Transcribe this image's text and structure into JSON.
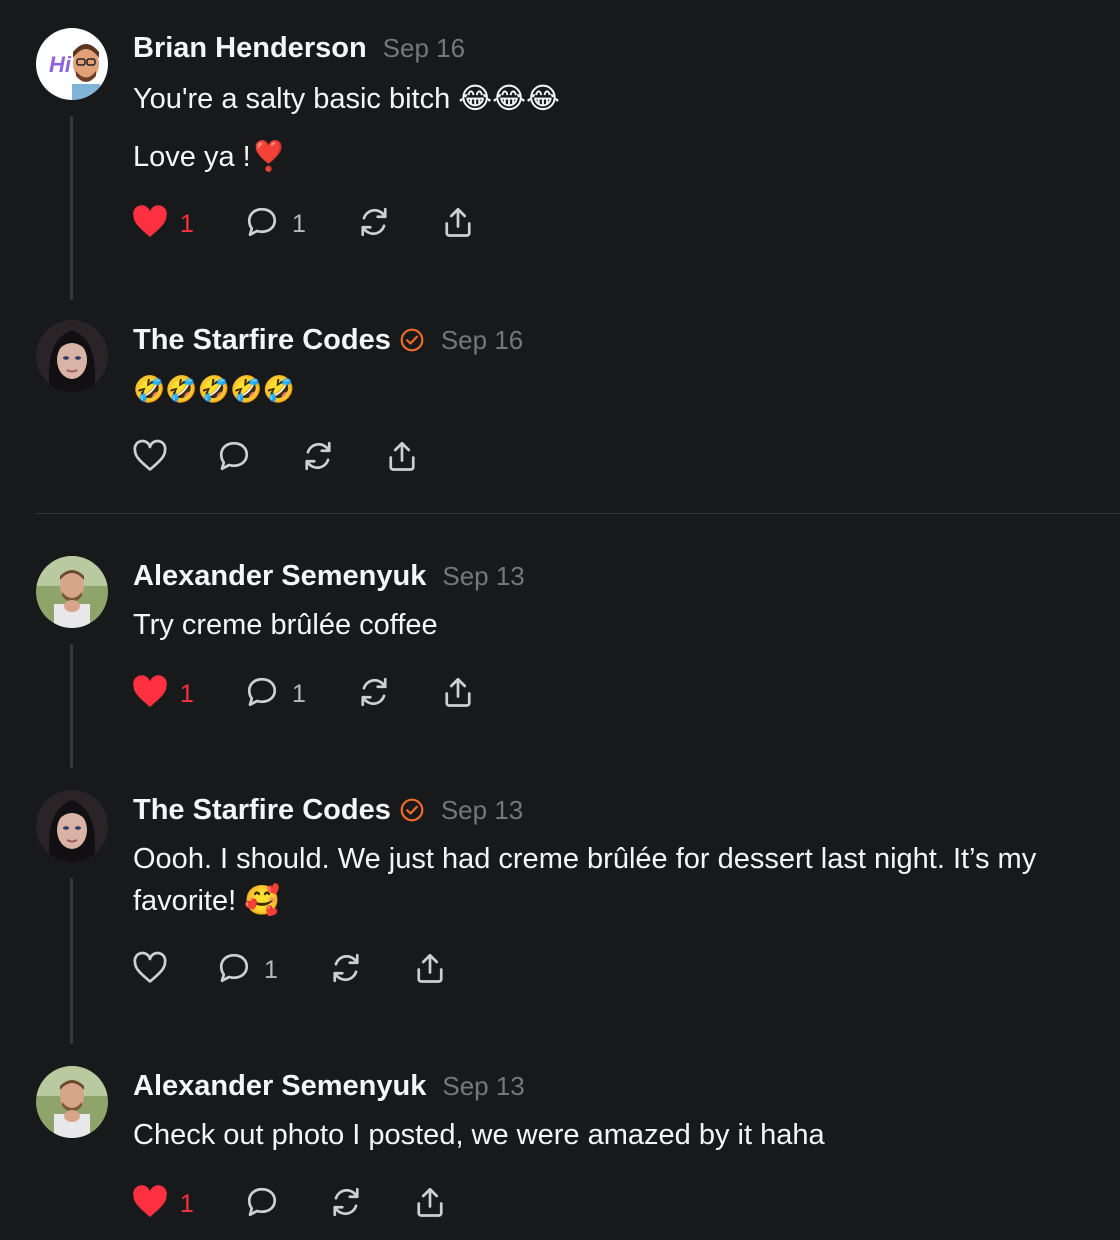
{
  "colors": {
    "background": "#18191b",
    "like_red": "#ff3040",
    "verified_orange": "#f26b2a",
    "muted": "#777777"
  },
  "posts": [
    {
      "author": "Brian Henderson",
      "date": "Sep 16",
      "verified": false,
      "avatar": "memoji-avatar",
      "lines": [
        "You're a salty basic bitch 😂😂😂",
        "Love ya !❣️"
      ],
      "liked": true,
      "likes": "1",
      "replies": "1"
    },
    {
      "author": "The Starfire Codes",
      "date": "Sep 16",
      "verified": true,
      "avatar": "woman-avatar",
      "lines": [
        "🤣🤣🤣🤣🤣"
      ],
      "liked": false,
      "likes": "",
      "replies": ""
    },
    {
      "author": "Alexander Semenyuk",
      "date": "Sep 13",
      "verified": false,
      "avatar": "man-avatar",
      "lines": [
        "Try creme brûlée coffee"
      ],
      "liked": true,
      "likes": "1",
      "replies": "1"
    },
    {
      "author": "The Starfire Codes",
      "date": "Sep 13",
      "verified": true,
      "avatar": "woman-avatar",
      "lines": [
        "Oooh. I should. We just had creme brûlée for dessert last night. It’s my favorite! 🥰"
      ],
      "liked": false,
      "likes": "",
      "replies": "1"
    },
    {
      "author": "Alexander Semenyuk",
      "date": "Sep 13",
      "verified": false,
      "avatar": "man-avatar",
      "lines": [
        "Check out photo I posted, we were amazed by it haha"
      ],
      "liked": true,
      "likes": "1",
      "replies": ""
    }
  ]
}
